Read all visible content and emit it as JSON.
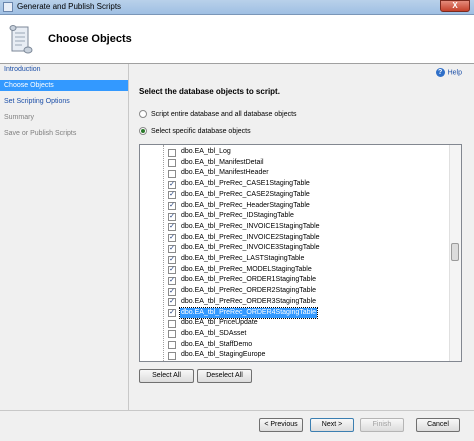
{
  "window": {
    "title": "Generate and Publish Scripts",
    "close_label": "X"
  },
  "header": {
    "title": "Choose Objects"
  },
  "sidebar": {
    "items": [
      {
        "label": "Introduction",
        "state": "link"
      },
      {
        "label": "Choose Objects",
        "state": "active"
      },
      {
        "label": "Set Scripting Options",
        "state": "link"
      },
      {
        "label": "Summary",
        "state": "disabled"
      },
      {
        "label": "Save or Publish Scripts",
        "state": "disabled"
      }
    ]
  },
  "main": {
    "help_label": "Help",
    "instruction": "Select the database objects to script.",
    "option_entire": "Script entire database and all database objects",
    "option_specific": "Select specific database objects",
    "selected_option": "specific"
  },
  "objects": [
    {
      "name": "dbo.EA_tbl_Log",
      "checked": false,
      "selected": false
    },
    {
      "name": "dbo.EA_tbl_ManifestDetail",
      "checked": false,
      "selected": false
    },
    {
      "name": "dbo.EA_tbl_ManifestHeader",
      "checked": false,
      "selected": false
    },
    {
      "name": "dbo.EA_tbl_PreRec_CASE1StagingTable",
      "checked": true,
      "selected": false
    },
    {
      "name": "dbo.EA_tbl_PreRec_CASE2StagingTable",
      "checked": true,
      "selected": false
    },
    {
      "name": "dbo.EA_tbl_PreRec_HeaderStagingTable",
      "checked": true,
      "selected": false
    },
    {
      "name": "dbo.EA_tbl_PreRec_IDStagingTable",
      "checked": true,
      "selected": false
    },
    {
      "name": "dbo.EA_tbl_PreRec_INVOICE1StagingTable",
      "checked": true,
      "selected": false
    },
    {
      "name": "dbo.EA_tbl_PreRec_INVOICE2StagingTable",
      "checked": true,
      "selected": false
    },
    {
      "name": "dbo.EA_tbl_PreRec_INVOICE3StagingTable",
      "checked": true,
      "selected": false
    },
    {
      "name": "dbo.EA_tbl_PreRec_LASTStagingTable",
      "checked": true,
      "selected": false
    },
    {
      "name": "dbo.EA_tbl_PreRec_MODELStagingTable",
      "checked": true,
      "selected": false
    },
    {
      "name": "dbo.EA_tbl_PreRec_ORDER1StagingTable",
      "checked": true,
      "selected": false
    },
    {
      "name": "dbo.EA_tbl_PreRec_ORDER2StagingTable",
      "checked": true,
      "selected": false
    },
    {
      "name": "dbo.EA_tbl_PreRec_ORDER3StagingTable",
      "checked": true,
      "selected": false
    },
    {
      "name": "dbo.EA_tbl_PreRec_ORDER4StagingTable",
      "checked": true,
      "selected": true
    },
    {
      "name": "dbo.EA_tbl_PriceUpdate",
      "checked": false,
      "selected": false
    },
    {
      "name": "dbo.EA_tbl_SDAsset",
      "checked": false,
      "selected": false
    },
    {
      "name": "dbo.EA_tbl_StaffDemo",
      "checked": false,
      "selected": false
    },
    {
      "name": "dbo.EA_tbl_StagingEurope",
      "checked": false,
      "selected": false
    }
  ],
  "buttons": {
    "select_all": "Select All",
    "deselect_all": "Deselect All",
    "previous": "< Previous",
    "next": "Next >",
    "finish": "Finish",
    "cancel": "Cancel"
  },
  "icons": {
    "app": "window-icon",
    "header": "script-scroll-icon",
    "help": "help-icon",
    "checkmark": "✓"
  }
}
